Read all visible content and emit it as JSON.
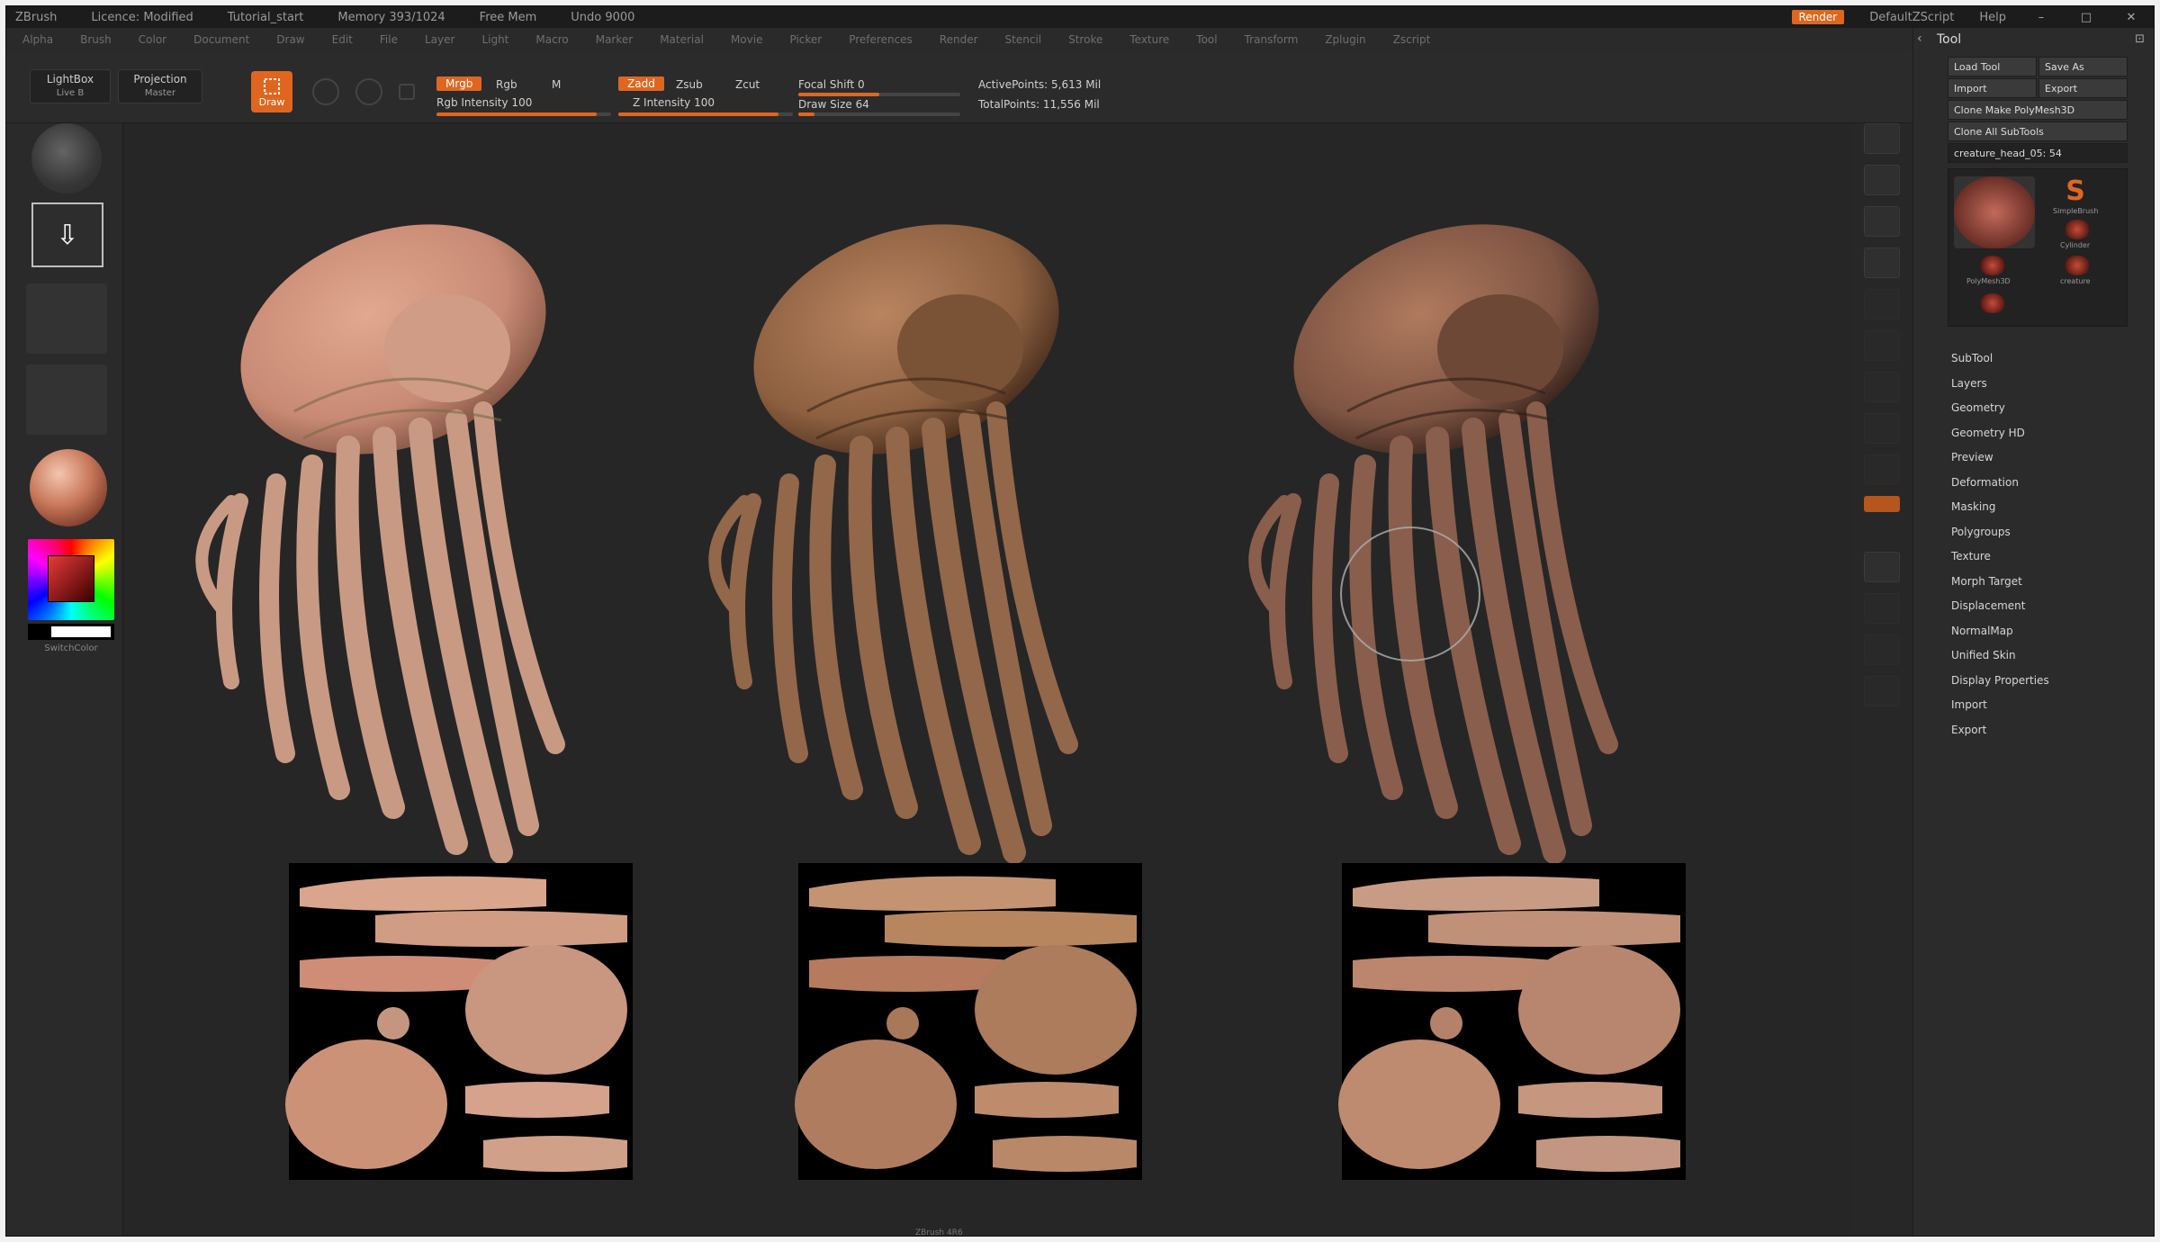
{
  "title_bar": {
    "segments": [
      "ZBrush",
      "Licence: Modified",
      "Tutorial_start",
      "Memory 393/1024",
      "Free Mem",
      "Undo 9000"
    ],
    "accent_button": "Render",
    "right_items": [
      "DefaultZScript",
      "Help"
    ]
  },
  "menubar": {
    "items": [
      "Alpha",
      "Brush",
      "Color",
      "Document",
      "Draw",
      "Edit",
      "File",
      "Layer",
      "Light",
      "Macro",
      "Marker",
      "Material",
      "Movie",
      "Picker",
      "Preferences",
      "Render",
      "Stencil",
      "Stroke",
      "Texture",
      "Tool",
      "Transform",
      "Zplugin",
      "Zscript"
    ]
  },
  "toolbar": {
    "lightbox_label": "LightBox",
    "lightbox_sub": "Live B",
    "projection_label": "Projection",
    "projection_sub": "Master",
    "draw_label": "Draw",
    "rgb_tag": "Mrgb",
    "rgb_label": "Rgb",
    "m_label": "M",
    "rgb_intensity": "Rgb Intensity 100",
    "zadd_tag": "Zadd",
    "zsub_label": "Zsub",
    "zcut_label": "Zcut",
    "z_intensity": "Z Intensity 100",
    "focal_shift": "Focal Shift 0",
    "draw_size": "Draw Size 64",
    "active_points": "ActivePoints: 5,613 Mil",
    "total_points": "TotalPoints: 11,556 Mil",
    "rgb_intensity_level": 0.92,
    "z_intensity_level": 0.92,
    "focal_level": 0.5,
    "drawsize_level": 0.1
  },
  "left_shelf": {
    "swatch_label": "SwitchColor"
  },
  "palette": {
    "title": "Tool",
    "buttons": [
      [
        "Load Tool",
        "Save As"
      ],
      [
        "Import",
        "Export"
      ]
    ],
    "wide_buttons": [
      "Clone  Make PolyMesh3D",
      "Clone All SubTools",
      "creature_head_05: 54"
    ],
    "thumb_captions": [
      "SimpleBrush",
      "Cylinder",
      "PolyMesh3D",
      "creature"
    ],
    "sections": [
      "SubTool",
      "Layers",
      "Geometry",
      "Geometry HD",
      "Preview",
      "Deformation",
      "Masking",
      "Polygroups",
      "Texture",
      "Morph Target",
      "Displacement",
      "NormalMap",
      "Unified Skin",
      "Display Properties",
      "Import",
      "Export"
    ]
  },
  "canvas": {
    "footer": "ZBrush 4R6"
  }
}
